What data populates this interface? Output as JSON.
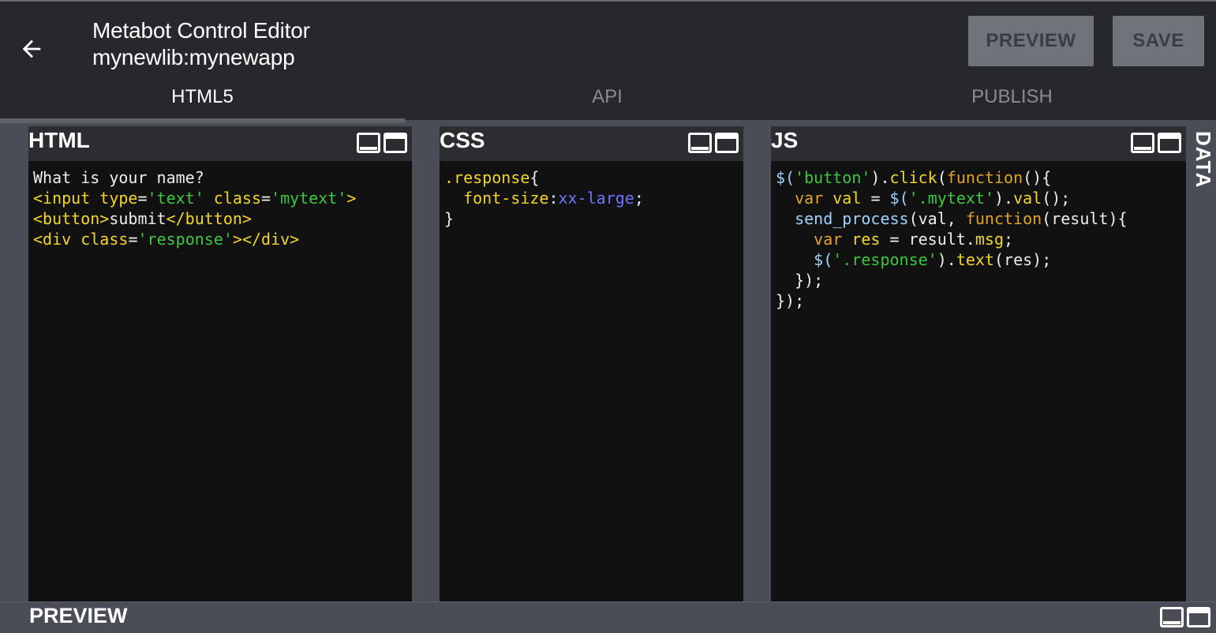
{
  "header": {
    "title": "Metabot Control Editor",
    "subtitle": "mynewlib:mynewapp",
    "preview_label": "PREVIEW",
    "save_label": "SAVE"
  },
  "tabs": [
    {
      "label": "HTML5",
      "active": true
    },
    {
      "label": "API",
      "active": false
    },
    {
      "label": "PUBLISH",
      "active": false
    }
  ],
  "panels": {
    "html": {
      "title": "HTML"
    },
    "css": {
      "title": "CSS"
    },
    "js": {
      "title": "JS"
    },
    "data": {
      "title": "DATA"
    },
    "preview": {
      "title": "PREVIEW"
    }
  },
  "code": {
    "html": [
      [
        {
          "t": "What is your name?",
          "c": "k-white"
        }
      ],
      [
        {
          "t": "<input ",
          "c": "k-yellow"
        },
        {
          "t": "type",
          "c": "k-yellow"
        },
        {
          "t": "=",
          "c": "k-white"
        },
        {
          "t": "'text'",
          "c": "k-green"
        },
        {
          "t": " class",
          "c": "k-yellow"
        },
        {
          "t": "=",
          "c": "k-white"
        },
        {
          "t": "'mytext'",
          "c": "k-green"
        },
        {
          "t": ">",
          "c": "k-yellow"
        }
      ],
      [
        {
          "t": "<button>",
          "c": "k-yellow"
        },
        {
          "t": "submit",
          "c": "k-white"
        },
        {
          "t": "</button>",
          "c": "k-yellow"
        }
      ],
      [
        {
          "t": "<div ",
          "c": "k-yellow"
        },
        {
          "t": "class",
          "c": "k-yellow"
        },
        {
          "t": "=",
          "c": "k-white"
        },
        {
          "t": "'response'",
          "c": "k-green"
        },
        {
          "t": "></div>",
          "c": "k-yellow"
        }
      ]
    ],
    "css": [
      [
        {
          "t": ".response",
          "c": "k-yellow"
        },
        {
          "t": "{",
          "c": "k-white"
        }
      ],
      [
        {
          "t": "  font-size",
          "c": "k-yellow"
        },
        {
          "t": ":",
          "c": "k-white"
        },
        {
          "t": "xx-large",
          "c": "k-blue"
        },
        {
          "t": ";",
          "c": "k-white"
        }
      ],
      [
        {
          "t": "}",
          "c": "k-white"
        }
      ]
    ],
    "js": [
      [
        {
          "t": "$(",
          "c": "k-cyan"
        },
        {
          "t": "'button'",
          "c": "k-green"
        },
        {
          "t": ").",
          "c": "k-white"
        },
        {
          "t": "click",
          "c": "k-yellow"
        },
        {
          "t": "(",
          "c": "k-white"
        },
        {
          "t": "function",
          "c": "k-orange"
        },
        {
          "t": "(){",
          "c": "k-white"
        }
      ],
      [
        {
          "t": "  ",
          "c": "k-white"
        },
        {
          "t": "var",
          "c": "k-orange"
        },
        {
          "t": " val ",
          "c": "k-yellow"
        },
        {
          "t": "= ",
          "c": "k-white"
        },
        {
          "t": "$(",
          "c": "k-cyan"
        },
        {
          "t": "'.mytext'",
          "c": "k-green"
        },
        {
          "t": ").",
          "c": "k-white"
        },
        {
          "t": "val",
          "c": "k-yellow"
        },
        {
          "t": "();",
          "c": "k-white"
        }
      ],
      [
        {
          "t": "  ",
          "c": "k-white"
        },
        {
          "t": "send_process",
          "c": "k-cyan"
        },
        {
          "t": "(val, ",
          "c": "k-white"
        },
        {
          "t": "function",
          "c": "k-orange"
        },
        {
          "t": "(result){",
          "c": "k-white"
        }
      ],
      [
        {
          "t": "    ",
          "c": "k-white"
        },
        {
          "t": "var",
          "c": "k-orange"
        },
        {
          "t": " res ",
          "c": "k-yellow"
        },
        {
          "t": "= result.",
          "c": "k-white"
        },
        {
          "t": "msg",
          "c": "k-yellow"
        },
        {
          "t": ";",
          "c": "k-white"
        }
      ],
      [
        {
          "t": "    ",
          "c": "k-white"
        },
        {
          "t": "$(",
          "c": "k-cyan"
        },
        {
          "t": "'.response'",
          "c": "k-green"
        },
        {
          "t": ").",
          "c": "k-white"
        },
        {
          "t": "text",
          "c": "k-yellow"
        },
        {
          "t": "(res);",
          "c": "k-white"
        }
      ],
      [
        {
          "t": "  });",
          "c": "k-white"
        }
      ],
      [
        {
          "t": "});",
          "c": "k-white"
        }
      ]
    ]
  }
}
